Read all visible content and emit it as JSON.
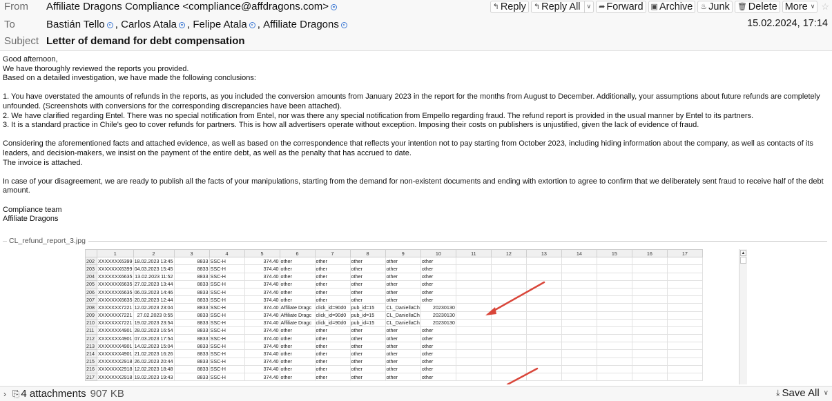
{
  "header": {
    "from_label": "From",
    "from_value": "Affiliate Dragons Compliance <compliance@affdragons.com>",
    "to_label": "To",
    "recipients": [
      "Bastián Tello",
      "Carlos Atala",
      "Felipe Atala",
      "Affiliate Dragons"
    ],
    "subject_label": "Subject",
    "subject": "Letter of demand for debt compensation",
    "date": "15.02.2024, 17:14"
  },
  "toolbar": {
    "reply": "Reply",
    "reply_all": "Reply All",
    "forward": "Forward",
    "archive": "Archive",
    "junk": "Junk",
    "delete": "Delete",
    "more": "More"
  },
  "body": {
    "greeting": "Good afternoon,",
    "line1": "We have thoroughly reviewed the reports you provided.",
    "line2": "Based on a detailed investigation, we have made the following conclusions:",
    "point1": "1. You have overstated the amounts of refunds in the reports, as you included the conversion amounts from January 2023 in the report for the months from August to December. Additionally, your assumptions about future refunds are completely unfounded. (Screenshots with conversions for the corresponding discrepancies have been attached).",
    "point2": "2. We have clarified regarding Entel. There was no special notification from Entel, nor was there any special notification from Empello regarding fraud. The refund report is provided in the usual manner by Entel to its partners.",
    "point3": "3. It is a standard practice in Chile's geo to cover refunds for partners. This is how all advertisers operate without exception. Imposing their costs on publishers is unjustified, given the lack of evidence of fraud.",
    "para2": "Considering the aforementioned facts and attached evidence, as well as based on the correspondence that reflects your intention not to pay starting from October 2023, including hiding information about the company, as well as contacts of its leaders, and decision-makers, we insist on the payment of the entire debt, as well as the penalty that has accrued to date.",
    "para2b": "The invoice is attached.",
    "para3": "In case of your disagreement, we are ready to publish all the facts of your manipulations, starting from the demand for non-existent documents and ending with extortion to agree to confirm that we deliberately sent fraud to receive half of the debt amount.",
    "sign1": "Compliance team",
    "sign2": "Affiliate Dragons"
  },
  "attachment": {
    "filename": "CL_refund_report_3.jpg",
    "columns": [
      "1",
      "2",
      "3",
      "4",
      "5",
      "6",
      "7",
      "8",
      "9",
      "10",
      "11",
      "12",
      "13",
      "14",
      "15",
      "16",
      "17"
    ],
    "rows": [
      [
        "202",
        "XXXXXXX6399",
        "18.02.2023 13:45",
        "8833",
        "SSC-H",
        "374.40",
        "other",
        "other",
        "other",
        "other",
        "other"
      ],
      [
        "203",
        "XXXXXXX6399",
        "04.03.2023 15:45",
        "8833",
        "SSC-H",
        "374.40",
        "other",
        "other",
        "other",
        "other",
        "other"
      ],
      [
        "204",
        "XXXXXXX6635",
        "13.02.2023 11:52",
        "8833",
        "SSC-H",
        "374.40",
        "other",
        "other",
        "other",
        "other",
        "other"
      ],
      [
        "205",
        "XXXXXXX6635",
        "27.02.2023 13:44",
        "8833",
        "SSC-H",
        "374.40",
        "other",
        "other",
        "other",
        "other",
        "other"
      ],
      [
        "206",
        "XXXXXXX6635",
        "06.03.2023 14:46",
        "8833",
        "SSC-H",
        "374.40",
        "other",
        "other",
        "other",
        "other",
        "other"
      ],
      [
        "207",
        "XXXXXXX6635",
        "20.02.2023 12:44",
        "8833",
        "SSC-H",
        "374.40",
        "other",
        "other",
        "other",
        "other",
        "other"
      ],
      [
        "208",
        "XXXXXXX7221",
        "12.02.2023 23:04",
        "8833",
        "SSC-H",
        "374.40",
        "Affiliate Dragc",
        "click_id=90d0",
        "pub_id=15",
        "CL_DaniellaCh",
        "20230130"
      ],
      [
        "209",
        "XXXXXXX7221",
        "27.02.2023 0:55",
        "8833",
        "SSC-H",
        "374.40",
        "Affiliate Dragc",
        "click_id=90d0",
        "pub_id=15",
        "CL_DaniellaCh",
        "20230130"
      ],
      [
        "210",
        "XXXXXXX7221",
        "19.02.2023 23:54",
        "8833",
        "SSC-H",
        "374.40",
        "Affiliate Dragc",
        "click_id=90d0",
        "pub_id=15",
        "CL_DaniellaCh",
        "20230130"
      ],
      [
        "211",
        "XXXXXXX4901",
        "28.02.2023 16:54",
        "8833",
        "SSC-H",
        "374.40",
        "other",
        "other",
        "other",
        "other",
        "other"
      ],
      [
        "212",
        "XXXXXXX4901",
        "07.03.2023 17:54",
        "8833",
        "SSC-H",
        "374.40",
        "other",
        "other",
        "other",
        "other",
        "other"
      ],
      [
        "213",
        "XXXXXXX4901",
        "14.02.2023 15:04",
        "8833",
        "SSC-H",
        "374.40",
        "other",
        "other",
        "other",
        "other",
        "other"
      ],
      [
        "214",
        "XXXXXXX4901",
        "21.02.2023 16:26",
        "8833",
        "SSC-H",
        "374.40",
        "other",
        "other",
        "other",
        "other",
        "other"
      ],
      [
        "215",
        "XXXXXXX2918",
        "26.02.2023 20:44",
        "8833",
        "SSC-H",
        "374.40",
        "other",
        "other",
        "other",
        "other",
        "other"
      ],
      [
        "216",
        "XXXXXXX2918",
        "12.02.2023 18:48",
        "8833",
        "SSC-H",
        "374.40",
        "other",
        "other",
        "other",
        "other",
        "other"
      ],
      [
        "217",
        "XXXXXXX2918",
        "19.02.2023 19:43",
        "8833",
        "SSC-H",
        "374.40",
        "other",
        "other",
        "other",
        "other",
        "other"
      ]
    ],
    "arrow_color": "#d9463a"
  },
  "footer": {
    "attachments_label": "4 attachments",
    "total_size": "907 KB",
    "save_all": "Save All"
  },
  "colors": {
    "contact_icon": "#3d79d4",
    "header_bg": "#f8f8f8"
  }
}
